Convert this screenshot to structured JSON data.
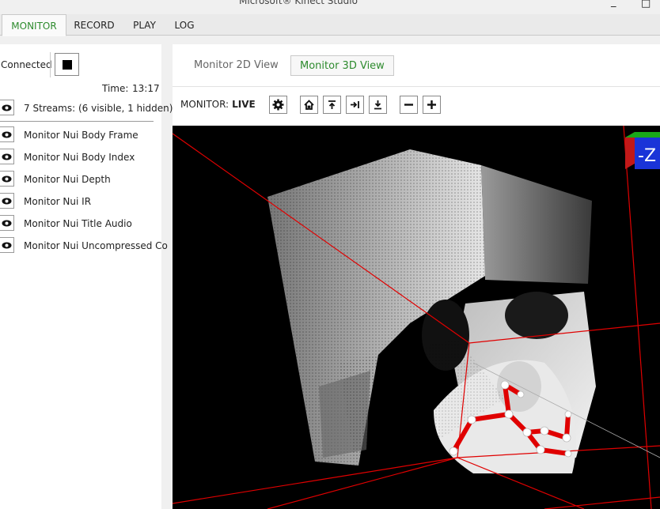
{
  "window": {
    "title": "Microsoft® Kinect Studio"
  },
  "tabs": [
    {
      "label": "MONITOR",
      "active": true
    },
    {
      "label": "RECORD",
      "active": false
    },
    {
      "label": "PLAY",
      "active": false
    },
    {
      "label": "LOG",
      "active": false
    }
  ],
  "connection": {
    "status": "Connected"
  },
  "time": {
    "label": "Time:",
    "value": "13:17"
  },
  "streams": {
    "summary": "7 Streams: (6 visible, 1 hidden)",
    "items": [
      "Monitor Nui Body Frame",
      "Monitor Nui Body Index",
      "Monitor Nui Depth",
      "Monitor Nui IR",
      "Monitor Nui Title Audio",
      "Monitor Nui Uncompressed Co"
    ]
  },
  "view_tabs": [
    {
      "label": "Monitor 2D View",
      "active": false
    },
    {
      "label": "Monitor 3D View",
      "active": true
    }
  ],
  "toolbar": {
    "label": "MONITOR:",
    "state": "LIVE"
  },
  "orientation_cube": {
    "label": "-Z"
  },
  "icons": [
    "eye-icon",
    "gear-icon",
    "home-icon",
    "up-icon",
    "right-icon",
    "download-icon",
    "minus-icon",
    "plus-icon",
    "stop-icon"
  ]
}
